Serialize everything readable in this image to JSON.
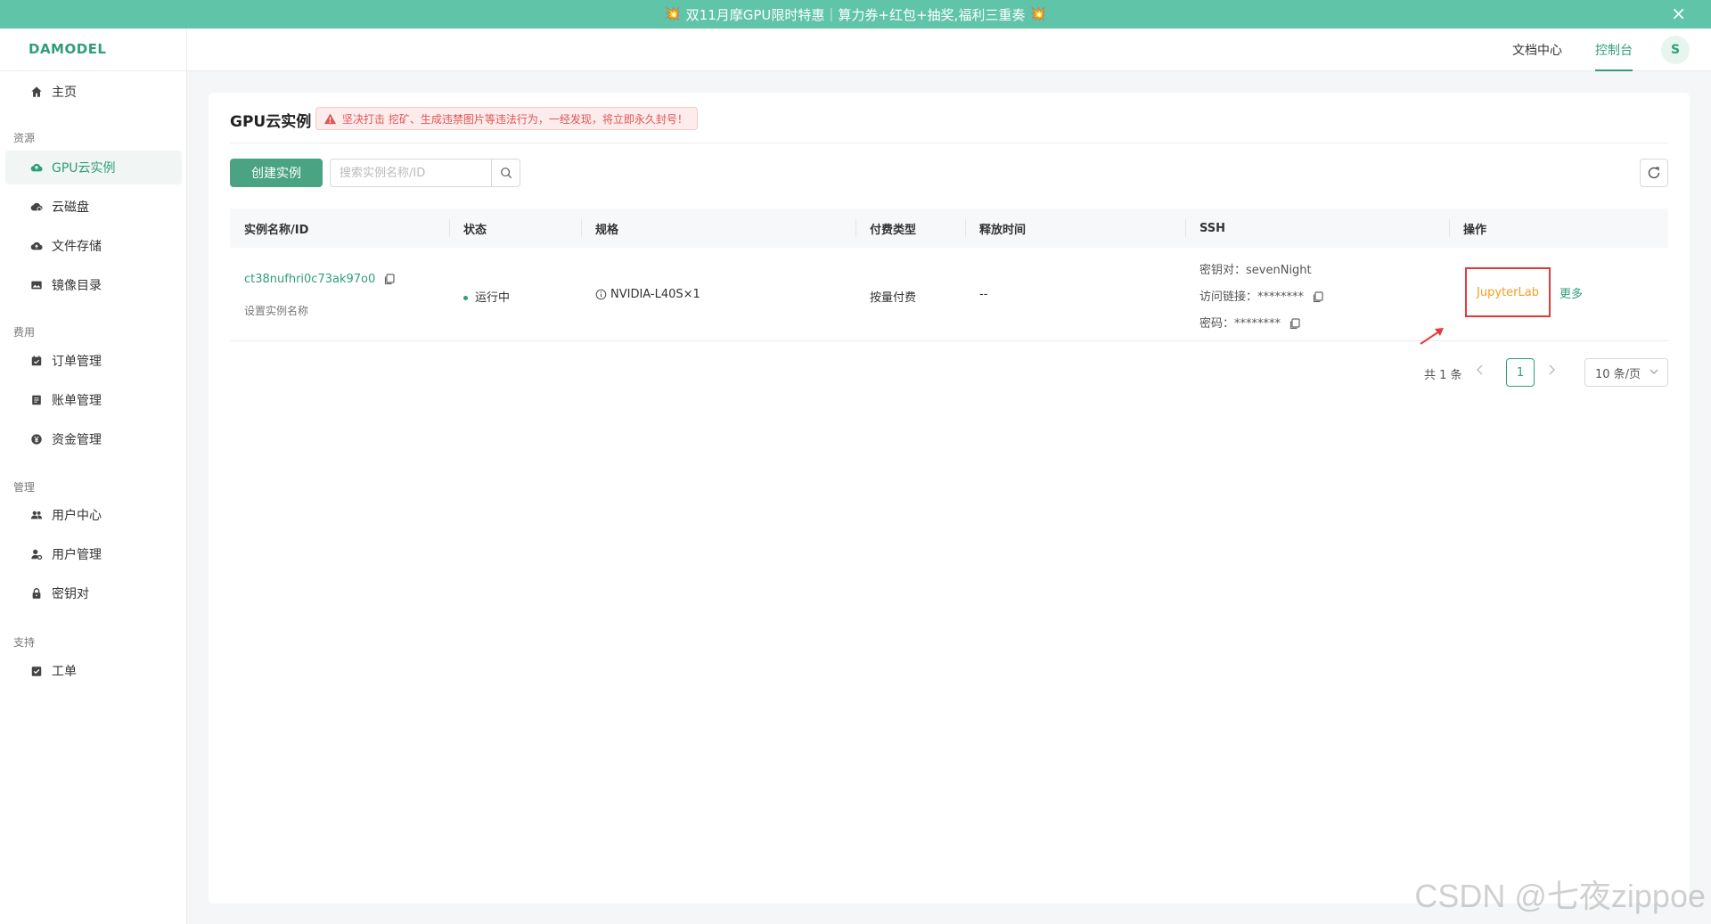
{
  "banner": {
    "text": "双11月摩GPU限时特惠｜算力券+红包+抽奖,福利三重奏",
    "boom_icon": "💥",
    "close_icon": "×"
  },
  "header": {
    "logo": "DAMODEL",
    "links": {
      "docs": "文档中心",
      "console": "控制台"
    },
    "avatar_initial": "S",
    "accent_color": "#2e9e7a"
  },
  "sidebar": {
    "items": [
      {
        "label": "主页",
        "icon": "home-icon"
      },
      {
        "label": "GPU云实例",
        "icon": "cloud-icon",
        "active": true
      },
      {
        "label": "云磁盘",
        "icon": "cloud-disk-icon"
      },
      {
        "label": "文件存储",
        "icon": "cloud-upload-icon"
      },
      {
        "label": "镜像目录",
        "icon": "image-icon"
      },
      {
        "label": "订单管理",
        "icon": "calendar-icon"
      },
      {
        "label": "账单管理",
        "icon": "list-icon"
      },
      {
        "label": "资金管理",
        "icon": "yuan-icon"
      },
      {
        "label": "用户中心",
        "icon": "users-icon"
      },
      {
        "label": "用户管理",
        "icon": "user-settings-icon"
      },
      {
        "label": "密钥对",
        "icon": "lock-icon"
      },
      {
        "label": "工单",
        "icon": "check-square-icon"
      }
    ],
    "sections": {
      "resources": "资源",
      "billing": "费用",
      "manage": "管理",
      "support": "支持"
    }
  },
  "main": {
    "title": "GPU云实例",
    "warning": "坚决打击 挖矿、生成违禁图片等违法行为，一经发现，将立即永久封号！",
    "create_button": "创建实例",
    "search_placeholder": "搜索实例名称/ID",
    "table": {
      "headers": [
        "实例名称/ID",
        "状态",
        "规格",
        "付费类型",
        "释放时间",
        "SSH",
        "操作"
      ],
      "rows": [
        {
          "id": "ct38nufhri0c73ak97o0",
          "name_hint": "设置实例名称",
          "status": "运行中",
          "spec": "NVIDIA-L40S×1",
          "pay_type": "按量付费",
          "release_time": "--",
          "ssh_key_label": "密钥对：",
          "ssh_key_value": "sevenNight",
          "ssh_link_label": "访问链接：",
          "ssh_link_value": "********",
          "ssh_pwd_label": "密码：",
          "ssh_pwd_value": "********",
          "op_jupyter": "JupyterLab",
          "op_more": "更多"
        }
      ]
    },
    "pagination": {
      "total": "共 1 条",
      "current_page": "1",
      "page_size": "10 条/页"
    }
  },
  "watermark": "CSDN @七夜zippoe"
}
